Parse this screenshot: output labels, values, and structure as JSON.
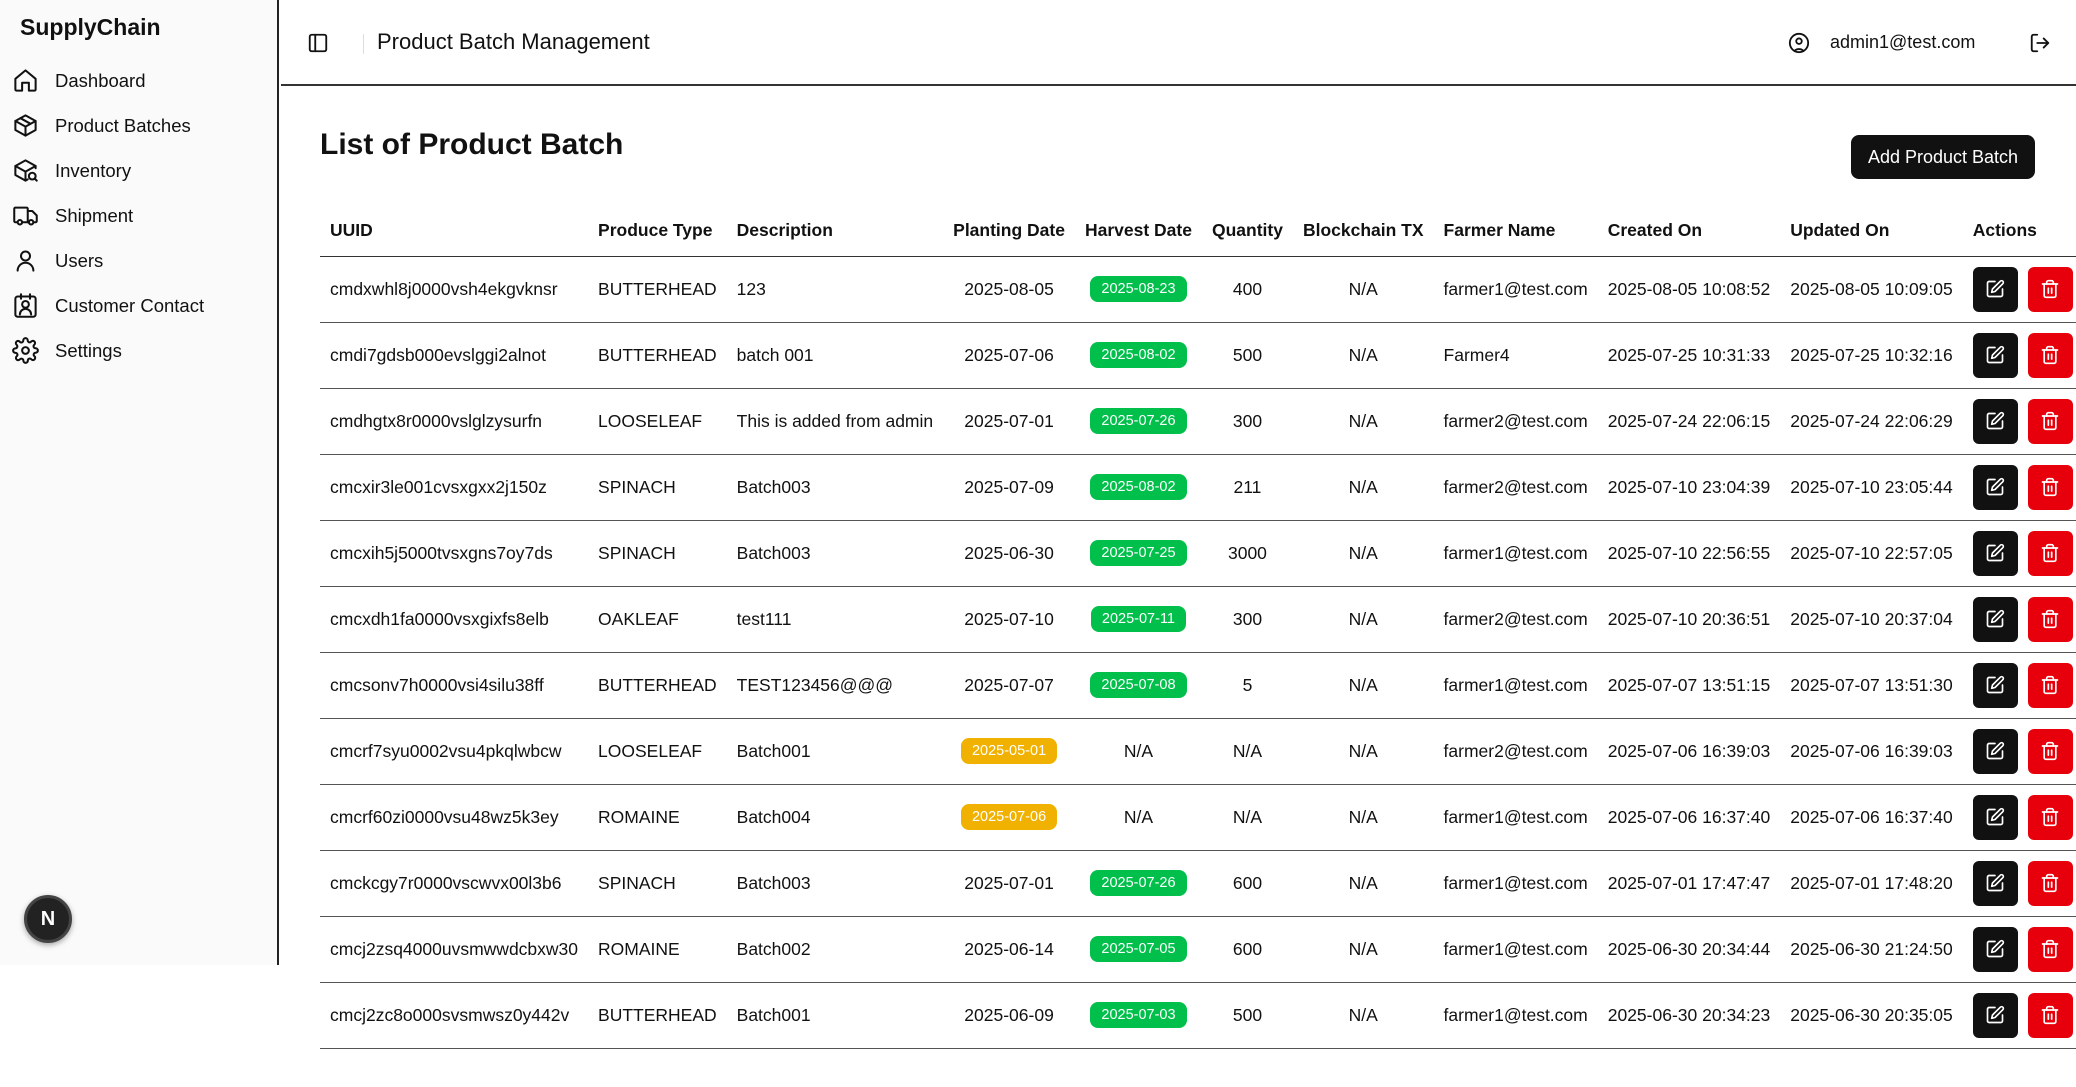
{
  "app": {
    "brand": "SupplyChain"
  },
  "sidebar": {
    "items": [
      {
        "label": "Dashboard",
        "icon": "home-icon",
        "name": "sidebar-item-dashboard"
      },
      {
        "label": "Product Batches",
        "icon": "package-icon",
        "name": "sidebar-item-product-batches"
      },
      {
        "label": "Inventory",
        "icon": "package-search-icon",
        "name": "sidebar-item-inventory"
      },
      {
        "label": "Shipment",
        "icon": "truck-icon",
        "name": "sidebar-item-shipment"
      },
      {
        "label": "Users",
        "icon": "user-icon",
        "name": "sidebar-item-users"
      },
      {
        "label": "Customer Contact",
        "icon": "contact-icon",
        "name": "sidebar-item-customer-contact"
      },
      {
        "label": "Settings",
        "icon": "gear-icon",
        "name": "sidebar-item-settings"
      }
    ],
    "fab_label": "N"
  },
  "header": {
    "title": "Product Batch Management",
    "user_email": "admin1@test.com"
  },
  "main": {
    "heading": "List of Product Batch",
    "add_button": "Add Product Batch"
  },
  "colors": {
    "harvest_badge": "#00c04b",
    "planting_badge": "#f0b100",
    "delete_button": "#e7000b",
    "edit_button": "#111111"
  },
  "table": {
    "columns": [
      "UUID",
      "Produce Type",
      "Description",
      "Planting Date",
      "Harvest Date",
      "Quantity",
      "Blockchain TX",
      "Farmer Name",
      "Created On",
      "Updated On",
      "Actions"
    ],
    "rows": [
      {
        "uuid": "cmdxwhl8j0000vsh4ekgvknsr",
        "produce": "BUTTERHEAD",
        "description": "123",
        "planting": "2025-08-05",
        "planting_badge": false,
        "harvest": "2025-08-23",
        "harvest_badge": true,
        "quantity": "400",
        "tx": "N/A",
        "farmer": "farmer1@test.com",
        "created": "2025-08-05 10:08:52",
        "updated": "2025-08-05 10:09:05"
      },
      {
        "uuid": "cmdi7gdsb000evslggi2alnot",
        "produce": "BUTTERHEAD",
        "description": "batch 001",
        "planting": "2025-07-06",
        "planting_badge": false,
        "harvest": "2025-08-02",
        "harvest_badge": true,
        "quantity": "500",
        "tx": "N/A",
        "farmer": "Farmer4",
        "created": "2025-07-25 10:31:33",
        "updated": "2025-07-25 10:32:16"
      },
      {
        "uuid": "cmdhgtx8r0000vslglzysurfn",
        "produce": "LOOSELEAF",
        "description": "This is added from admin",
        "planting": "2025-07-01",
        "planting_badge": false,
        "harvest": "2025-07-26",
        "harvest_badge": true,
        "quantity": "300",
        "tx": "N/A",
        "farmer": "farmer2@test.com",
        "created": "2025-07-24 22:06:15",
        "updated": "2025-07-24 22:06:29"
      },
      {
        "uuid": "cmcxir3le001cvsxgxx2j150z",
        "produce": "SPINACH",
        "description": "Batch003",
        "planting": "2025-07-09",
        "planting_badge": false,
        "harvest": "2025-08-02",
        "harvest_badge": true,
        "quantity": "211",
        "tx": "N/A",
        "farmer": "farmer2@test.com",
        "created": "2025-07-10 23:04:39",
        "updated": "2025-07-10 23:05:44"
      },
      {
        "uuid": "cmcxih5j5000tvsxgns7oy7ds",
        "produce": "SPINACH",
        "description": "Batch003",
        "planting": "2025-06-30",
        "planting_badge": false,
        "harvest": "2025-07-25",
        "harvest_badge": true,
        "quantity": "3000",
        "tx": "N/A",
        "farmer": "farmer1@test.com",
        "created": "2025-07-10 22:56:55",
        "updated": "2025-07-10 22:57:05"
      },
      {
        "uuid": "cmcxdh1fa0000vsxgixfs8elb",
        "produce": "OAKLEAF",
        "description": "test111",
        "planting": "2025-07-10",
        "planting_badge": false,
        "harvest": "2025-07-11",
        "harvest_badge": true,
        "quantity": "300",
        "tx": "N/A",
        "farmer": "farmer2@test.com",
        "created": "2025-07-10 20:36:51",
        "updated": "2025-07-10 20:37:04"
      },
      {
        "uuid": "cmcsonv7h0000vsi4silu38ff",
        "produce": "BUTTERHEAD",
        "description": "TEST123456@@@",
        "planting": "2025-07-07",
        "planting_badge": false,
        "harvest": "2025-07-08",
        "harvest_badge": true,
        "quantity": "5",
        "tx": "N/A",
        "farmer": "farmer1@test.com",
        "created": "2025-07-07 13:51:15",
        "updated": "2025-07-07 13:51:30"
      },
      {
        "uuid": "cmcrf7syu0002vsu4pkqlwbcw",
        "produce": "LOOSELEAF",
        "description": "Batch001",
        "planting": "2025-05-01",
        "planting_badge": true,
        "harvest": "N/A",
        "harvest_badge": false,
        "quantity": "N/A",
        "tx": "N/A",
        "farmer": "farmer2@test.com",
        "created": "2025-07-06 16:39:03",
        "updated": "2025-07-06 16:39:03"
      },
      {
        "uuid": "cmcrf60zi0000vsu48wz5k3ey",
        "produce": "ROMAINE",
        "description": "Batch004",
        "planting": "2025-07-06",
        "planting_badge": true,
        "harvest": "N/A",
        "harvest_badge": false,
        "quantity": "N/A",
        "tx": "N/A",
        "farmer": "farmer1@test.com",
        "created": "2025-07-06 16:37:40",
        "updated": "2025-07-06 16:37:40"
      },
      {
        "uuid": "cmckcgy7r0000vscwvx00l3b6",
        "produce": "SPINACH",
        "description": "Batch003",
        "planting": "2025-07-01",
        "planting_badge": false,
        "harvest": "2025-07-26",
        "harvest_badge": true,
        "quantity": "600",
        "tx": "N/A",
        "farmer": "farmer1@test.com",
        "created": "2025-07-01 17:47:47",
        "updated": "2025-07-01 17:48:20"
      },
      {
        "uuid": "cmcj2zsq4000uvsmwwdcbxw30",
        "produce": "ROMAINE",
        "description": "Batch002",
        "planting": "2025-06-14",
        "planting_badge": false,
        "harvest": "2025-07-05",
        "harvest_badge": true,
        "quantity": "600",
        "tx": "N/A",
        "farmer": "farmer1@test.com",
        "created": "2025-06-30 20:34:44",
        "updated": "2025-06-30 21:24:50"
      },
      {
        "uuid": "cmcj2zc8o000svsmwsz0y442v",
        "produce": "BUTTERHEAD",
        "description": "Batch001",
        "planting": "2025-06-09",
        "planting_badge": false,
        "harvest": "2025-07-03",
        "harvest_badge": true,
        "quantity": "500",
        "tx": "N/A",
        "farmer": "farmer1@test.com",
        "created": "2025-06-30 20:34:23",
        "updated": "2025-06-30 20:35:05"
      }
    ]
  }
}
